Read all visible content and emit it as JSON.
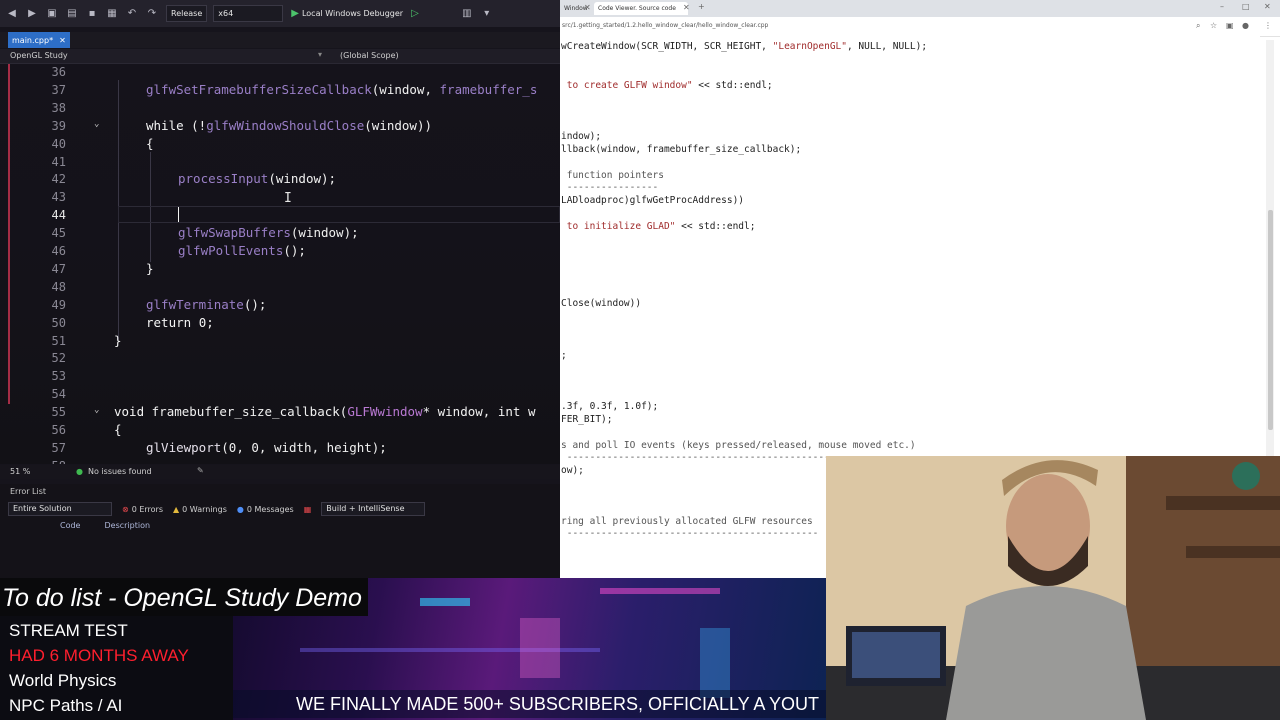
{
  "ide": {
    "toolbar": {
      "config": "Release",
      "platform": "x64",
      "debugger": "Local Windows Debugger"
    },
    "tab": {
      "label": "main.cpp*"
    },
    "nav": {
      "project": "OpenGL Study",
      "scope": "(Global Scope)"
    },
    "code_lines": [
      {
        "n": "36"
      },
      {
        "n": "37",
        "parts": [
          [
            "fnd",
            "glfwSetFramebufferSizeCallback"
          ],
          [
            "pm",
            "(window, "
          ],
          [
            "fnd",
            "framebuffer_s"
          ]
        ]
      },
      {
        "n": "38"
      },
      {
        "n": "39",
        "parts": [
          [
            "k",
            "while "
          ],
          [
            "pm",
            "(!"
          ],
          [
            "fnd",
            "glfwWindowShouldClose"
          ],
          [
            "pm",
            "(window))"
          ]
        ]
      },
      {
        "n": "40",
        "parts": [
          [
            "pm",
            "{"
          ]
        ]
      },
      {
        "n": "41"
      },
      {
        "n": "42",
        "parts": [
          [
            "fnd",
            "processInput"
          ],
          [
            "pm",
            "(window);"
          ]
        ]
      },
      {
        "n": "43"
      },
      {
        "n": "44"
      },
      {
        "n": "45",
        "parts": [
          [
            "fnd",
            "glfwSwapBuffers"
          ],
          [
            "pm",
            "(window);"
          ]
        ]
      },
      {
        "n": "46",
        "parts": [
          [
            "fnd",
            "glfwPollEvents"
          ],
          [
            "pm",
            "();"
          ]
        ]
      },
      {
        "n": "47",
        "parts": [
          [
            "pm",
            "}"
          ]
        ]
      },
      {
        "n": "48"
      },
      {
        "n": "49",
        "parts": [
          [
            "fnd",
            "glfwTerminate"
          ],
          [
            "pm",
            "();"
          ]
        ]
      },
      {
        "n": "50",
        "parts": [
          [
            "k",
            "return "
          ],
          [
            "num",
            "0"
          ],
          [
            "pm",
            ";"
          ]
        ]
      },
      {
        "n": "51",
        "parts": [
          [
            "pm",
            "}"
          ]
        ]
      },
      {
        "n": "52"
      },
      {
        "n": "53"
      },
      {
        "n": "54"
      },
      {
        "n": "55",
        "parts": [
          [
            "k",
            "void "
          ],
          [
            "pm",
            "framebuffer_size_callback("
          ],
          [
            "ty",
            "GLFWwindow"
          ],
          [
            "pm",
            "* window, "
          ],
          [
            "k",
            "int "
          ],
          [
            "pm",
            "w"
          ]
        ]
      },
      {
        "n": "56",
        "parts": [
          [
            "pm",
            "{"
          ]
        ]
      },
      {
        "n": "57",
        "parts": [
          [
            "fn",
            "glViewport"
          ],
          [
            "pm",
            "(0, 0, width, height);"
          ]
        ]
      },
      {
        "n": "58"
      }
    ],
    "status": {
      "zoom": "51 %",
      "issues": "No issues found"
    },
    "error_list": {
      "title": "Error List",
      "scope": "Entire Solution",
      "errors": "0 Errors",
      "warnings": "0 Warnings",
      "messages": "0 Messages",
      "filter": "Build + IntelliSense",
      "col_code": "Code",
      "col_description": "Description"
    }
  },
  "browser": {
    "tabs": [
      {
        "label": "Window"
      },
      {
        "label": "Code Viewer. Source code sh"
      }
    ],
    "url": "src/1.getting_started/1.2.hello_window_clear/hello_window_clear.cpp",
    "lines": [
      {
        "text": "wCreateWindow(SCR_WIDTH, SCR_HEIGHT, ",
        "str": "\"LearnOpenGL\"",
        "rest": ", NULL, NULL);"
      },
      {
        "text": "",
        "str": " to create GLFW window\"",
        "rest": " << std::endl;"
      },
      {
        "text": "indow);"
      },
      {
        "text": "llback(window, framebuffer_size_callback);"
      },
      {
        "text": " function pointers",
        "cm": true
      },
      {
        "text": " ----------------",
        "cm": true
      },
      {
        "text": "LADloadproc)glfwGetProcAddress))"
      },
      {
        "text": "",
        "str": " to initialize GLAD\"",
        "rest": " << std::endl;"
      },
      {
        "text": "Close(window))"
      },
      {
        "text": ";"
      },
      {
        "text": ".3f, 0.3f, 1.0f);"
      },
      {
        "text": "FER_BIT);"
      },
      {
        "text": "s and poll IO events (keys pressed/released, mouse moved etc.)",
        "cm": true
      },
      {
        "text": " -----------------------------------------------------------",
        "cm": true
      },
      {
        "text": "ow);"
      },
      {
        "text": "ring all previously allocated GLFW resources",
        "cm": true
      },
      {
        "text": " --------------------------------------------",
        "cm": true
      }
    ]
  },
  "overlay": {
    "title": "To do list - OpenGL Study Demo",
    "items": [
      {
        "label": "STREAM TEST",
        "color": "#ffffff"
      },
      {
        "label": "HAD 6 MONTHS AWAY",
        "color": "#ff1f2e"
      },
      {
        "label": "World Physics",
        "color": "#ffffff"
      },
      {
        "label": "NPC Paths / AI",
        "color": "#ffffff"
      }
    ],
    "ticker": "WE FINALLY MADE 500+ SUBSCRIBERS, OFFICIALLY A YOUT"
  }
}
